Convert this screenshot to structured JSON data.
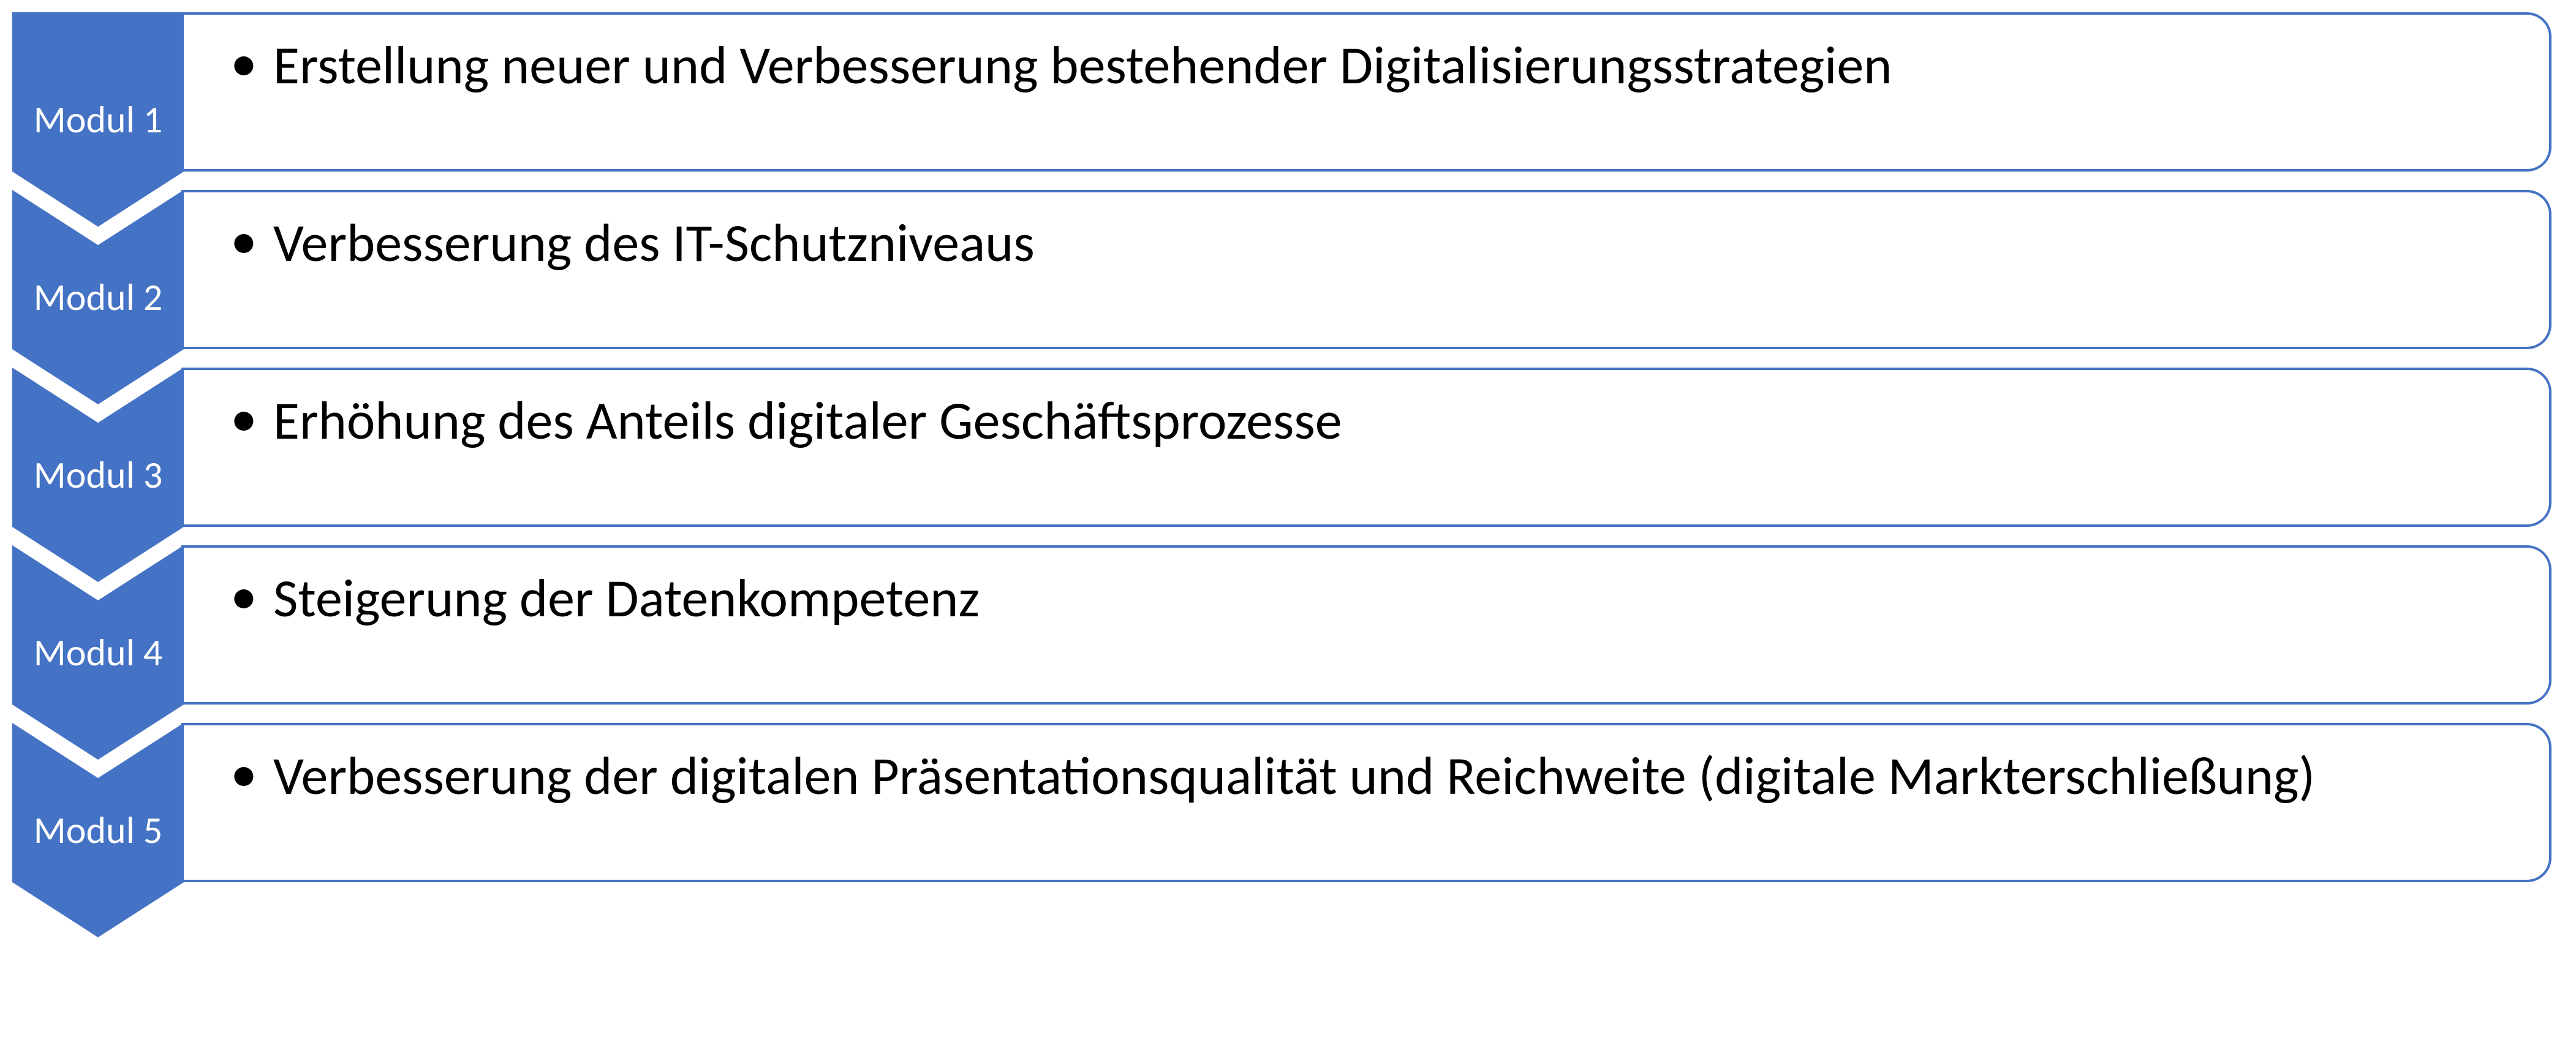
{
  "modules": [
    {
      "label": "Modul 1",
      "bullet": "Erstellung neuer und Verbesserung bestehender Digitalisierungsstrategien"
    },
    {
      "label": "Modul 2",
      "bullet": "Verbesserung des IT-Schutzniveaus"
    },
    {
      "label": "Modul 3",
      "bullet": "Erhöhung des Anteils digitaler Geschäftsprozesse"
    },
    {
      "label": "Modul 4",
      "bullet": "Steigerung der Datenkompetenz"
    },
    {
      "label": "Modul 5",
      "bullet": "Verbesserung der digitalen Präsentationsqualität und Reichweite (digitale Markterschließung)"
    }
  ],
  "colors": {
    "chevron_fill": "#4472C4",
    "border": "#4472C4",
    "text": "#000000",
    "label_text": "#FFFFFF"
  }
}
